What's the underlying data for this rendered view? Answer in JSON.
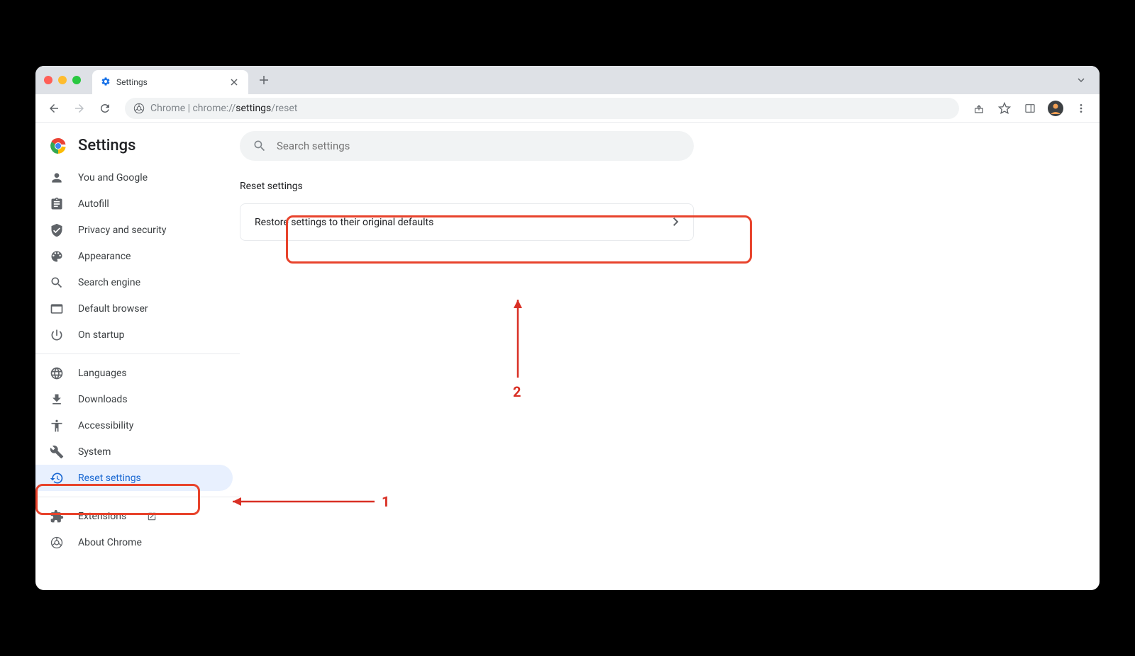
{
  "tab": {
    "title": "Settings"
  },
  "url": {
    "prefix": "Chrome  |  chrome://",
    "strong": "settings",
    "suffix": "/reset"
  },
  "page_title": "Settings",
  "search": {
    "placeholder": "Search settings"
  },
  "nav": {
    "group1": [
      {
        "label": "You and Google",
        "icon": "person"
      },
      {
        "label": "Autofill",
        "icon": "assignment"
      },
      {
        "label": "Privacy and security",
        "icon": "shield"
      },
      {
        "label": "Appearance",
        "icon": "palette"
      },
      {
        "label": "Search engine",
        "icon": "search"
      },
      {
        "label": "Default browser",
        "icon": "browser"
      },
      {
        "label": "On startup",
        "icon": "power"
      }
    ],
    "group2": [
      {
        "label": "Languages",
        "icon": "globe"
      },
      {
        "label": "Downloads",
        "icon": "download"
      },
      {
        "label": "Accessibility",
        "icon": "accessibility"
      },
      {
        "label": "System",
        "icon": "wrench"
      },
      {
        "label": "Reset settings",
        "icon": "restore",
        "active": true
      }
    ],
    "group3": [
      {
        "label": "Extensions",
        "icon": "extension",
        "external": true
      },
      {
        "label": "About Chrome",
        "icon": "chrome"
      }
    ]
  },
  "section": {
    "title": "Reset settings",
    "row_label": "Restore settings to their original defaults"
  },
  "annotations": {
    "label1": "1",
    "label2": "2"
  }
}
